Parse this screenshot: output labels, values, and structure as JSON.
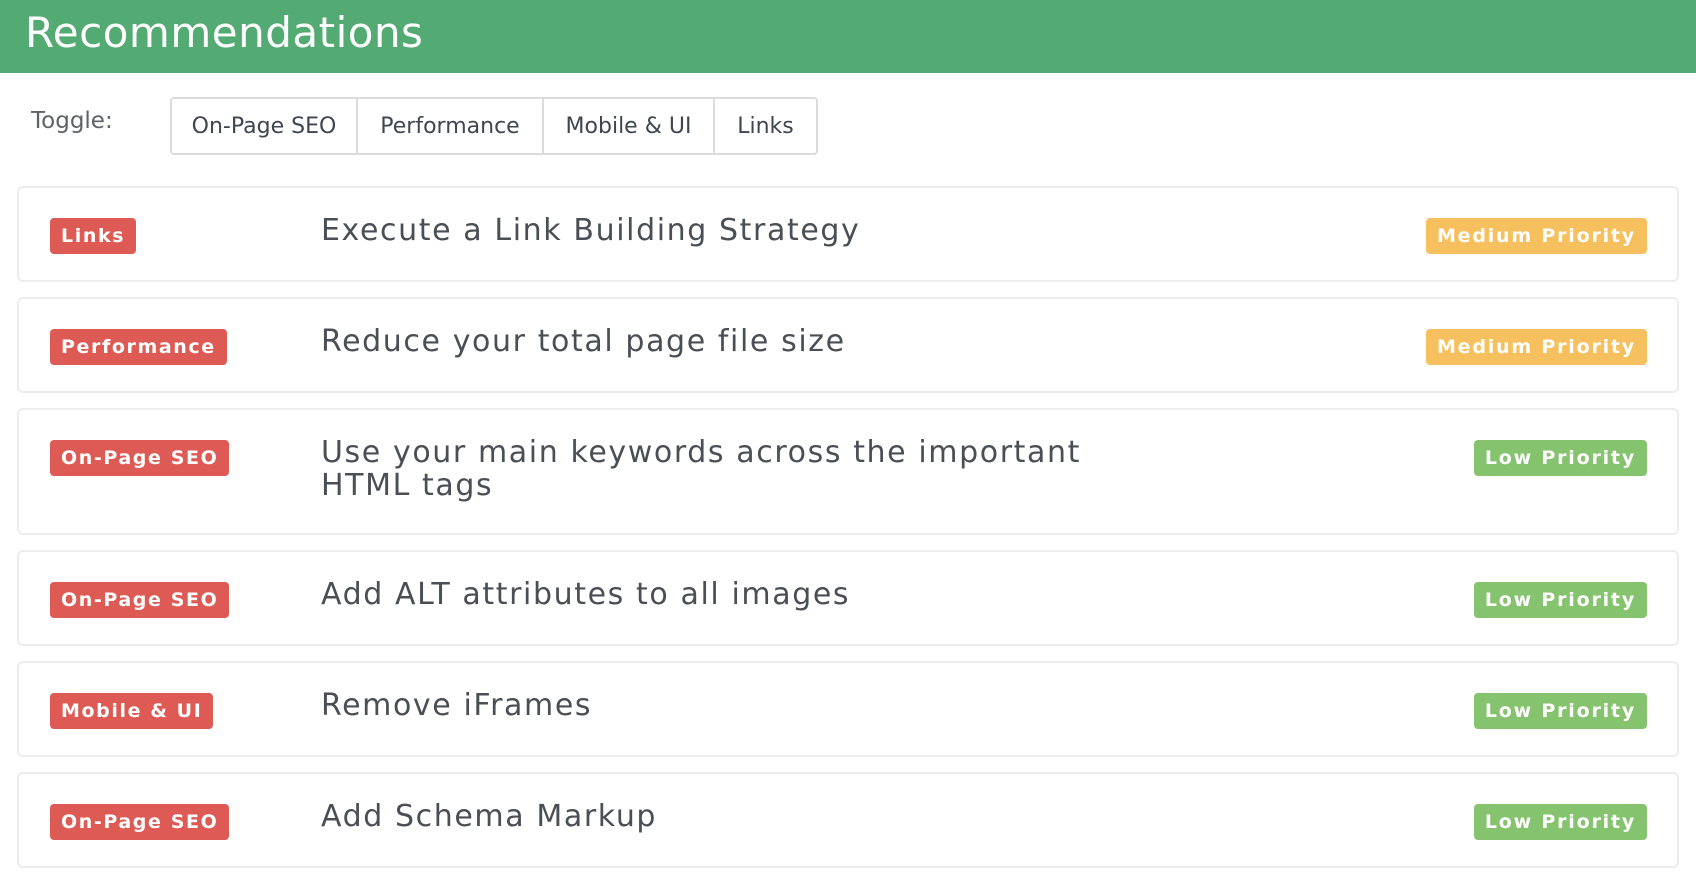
{
  "header": {
    "title": "Recommendations"
  },
  "toggle": {
    "label": "Toggle:",
    "buttons": [
      "On-Page SEO",
      "Performance",
      "Mobile & UI",
      "Links"
    ]
  },
  "colors": {
    "header_bg": "#53ab73",
    "category_badge": "#de5a54",
    "medium_priority": "#f6c05e",
    "low_priority": "#86c36e"
  },
  "recommendations": [
    {
      "category": "Links",
      "title": "Execute a Link Building Strategy",
      "priority": "Medium Priority"
    },
    {
      "category": "Performance",
      "title": "Reduce your total page file size",
      "priority": "Medium Priority"
    },
    {
      "category": "On-Page SEO",
      "title": "Use your main keywords across the important HTML tags",
      "priority": "Low Priority"
    },
    {
      "category": "On-Page SEO",
      "title": "Add ALT attributes to all images",
      "priority": "Low Priority"
    },
    {
      "category": "Mobile & UI",
      "title": "Remove iFrames",
      "priority": "Low Priority"
    },
    {
      "category": "On-Page SEO",
      "title": "Add Schema Markup",
      "priority": "Low Priority"
    }
  ]
}
